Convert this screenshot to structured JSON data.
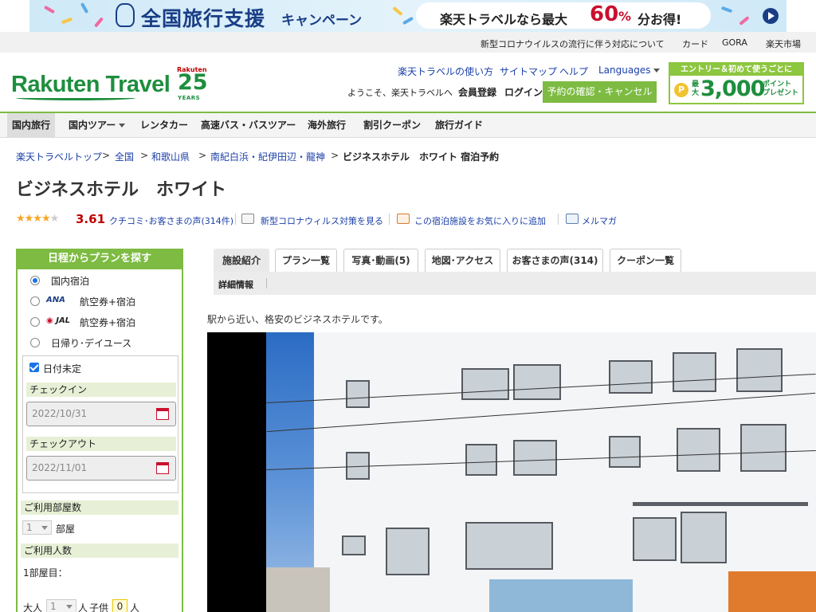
{
  "banner": {
    "title": "全国旅行支援",
    "campaign": "キャンペーン",
    "offer_prefix": "楽天トラベルなら最大",
    "offer_percent": "60",
    "offer_unit": "%",
    "offer_suffix": "分お得!"
  },
  "utility": {
    "corona": "新型コロナウイルスの流行に伴う対応について",
    "card": "カード",
    "gora": "GORA",
    "ichiba": "楽天市場"
  },
  "header": {
    "logo": "Rakuten Travel",
    "badge_brand": "Rakuten",
    "badge_years": "25",
    "badge_years_label": "YEARS",
    "links": [
      "楽天トラベルの使い方",
      "サイトマップ",
      "ヘルプ",
      "Languages"
    ],
    "welcome": "ようこそ、楽天トラベルへ",
    "register": "会員登録",
    "login": "ログイン",
    "confirm": "予約の確認・キャンセル",
    "entry_top": "エントリー＆初めて使うごとに",
    "entry_coin": "P",
    "entry_max": "最大",
    "entry_points": "3,000",
    "entry_pt1": "ポイント",
    "entry_pt2": "プレゼント"
  },
  "nav": [
    "国内旅行",
    "国内ツアー",
    "レンタカー",
    "高速バス・バスツアー",
    "海外旅行",
    "割引クーポン",
    "旅行ガイド"
  ],
  "breadcrumb": [
    "楽天トラベルトップ",
    "全国",
    "和歌山県",
    "南紀白浜・紀伊田辺・龍神",
    "ビジネスホテル　ホワイト 宿泊予約"
  ],
  "breadcrumb_sep": ">",
  "hotel": {
    "name": "ビジネスホテル　ホワイト",
    "stars": "★★★★",
    "star_off": "★",
    "score": "3.61",
    "reviews": "クチコミ･お客さまの声(314件)",
    "corona_link": "新型コロナウィルス対策を見る",
    "favorite": "この宿泊施設をお気に入りに追加",
    "mailmag": "メルマガ",
    "description": "駅から近い、格安のビジネスホテルです。"
  },
  "search": {
    "header": "日程からプランを探す",
    "options": [
      {
        "label": "国内宿泊",
        "selected": true
      },
      {
        "brand": "ANA",
        "label": "航空券+宿泊",
        "selected": false
      },
      {
        "brand": "JAL",
        "label": "航空券+宿泊",
        "selected": false
      },
      {
        "label": "日帰り･デイユース",
        "selected": false
      }
    ],
    "undecided": "日付未定",
    "checkin_label": "チェックイン",
    "checkin_value": "2022/10/31",
    "checkout_label": "チェックアウト",
    "checkout_value": "2022/11/01",
    "rooms_label": "ご利用部屋数",
    "rooms_value": "1",
    "rooms_unit": "部屋",
    "people_label": "ご利用人数",
    "room1": "1部屋目：",
    "adult_label": "大人",
    "adult_value": "1",
    "adult_unit": "人",
    "child_label": "子供",
    "child_value": "0",
    "child_unit": "人"
  },
  "tabs": [
    "施設紹介",
    "プラン一覧",
    "写真･動画(5)",
    "地図･アクセス",
    "お客さまの声(314)",
    "クーポン一覧"
  ],
  "subtab": "詳細情報",
  "colors": {
    "green": "#7dbb42",
    "link": "#1a3fa8",
    "red": "#bf0000"
  }
}
